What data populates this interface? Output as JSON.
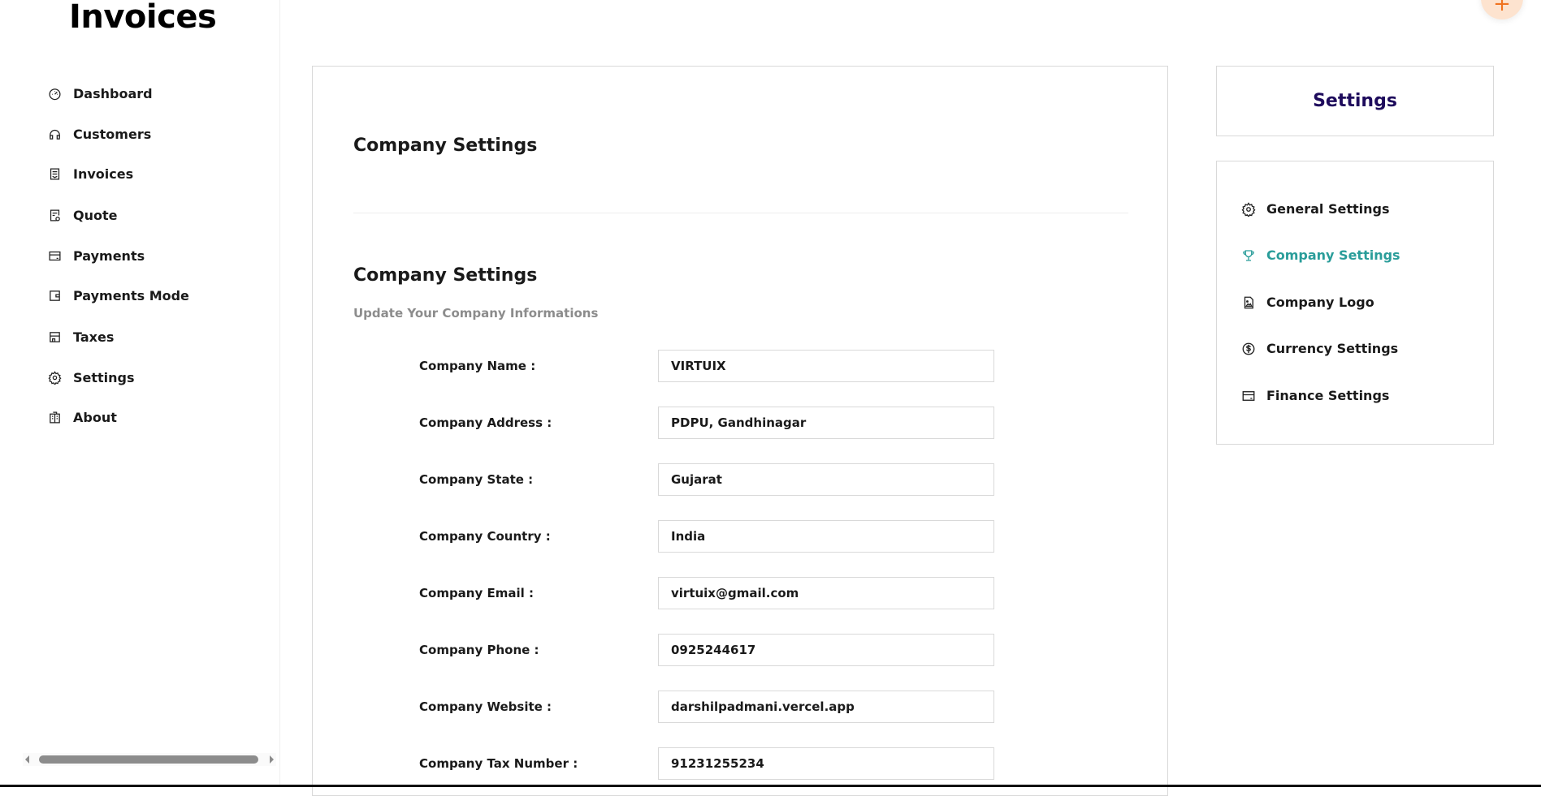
{
  "sidebar": {
    "brand": "Invoices",
    "items": [
      {
        "label": "Dashboard",
        "icon": "dashboard-icon"
      },
      {
        "label": "Customers",
        "icon": "headphones-icon"
      },
      {
        "label": "Invoices",
        "icon": "invoice-icon"
      },
      {
        "label": "Quote",
        "icon": "quote-icon"
      },
      {
        "label": "Payments",
        "icon": "credit-card-icon"
      },
      {
        "label": "Payments Mode",
        "icon": "wallet-icon"
      },
      {
        "label": "Taxes",
        "icon": "shop-icon"
      },
      {
        "label": "Settings",
        "icon": "gear-icon"
      },
      {
        "label": "About",
        "icon": "building-icon"
      }
    ]
  },
  "main": {
    "title": "Company Settings",
    "section_title": "Company Settings",
    "subtitle": "Update Your Company Informations",
    "fields": [
      {
        "label": "Company Name",
        "value": "VIRTUIX"
      },
      {
        "label": "Company Address",
        "value": "PDPU, Gandhinagar"
      },
      {
        "label": "Company State",
        "value": "Gujarat"
      },
      {
        "label": "Company Country",
        "value": "India"
      },
      {
        "label": "Company Email",
        "value": "virtuix@gmail.com"
      },
      {
        "label": "Company Phone",
        "value": "0925244617"
      },
      {
        "label": "Company Website",
        "value": "darshilpadmani.vercel.app"
      },
      {
        "label": "Company Tax Number",
        "value": "91231255234"
      }
    ]
  },
  "settings_panel": {
    "title": "Settings",
    "items": [
      {
        "label": "General Settings",
        "icon": "gear-icon"
      },
      {
        "label": "Company Settings",
        "icon": "trophy-icon",
        "active": true
      },
      {
        "label": "Company Logo",
        "icon": "file-image-icon"
      },
      {
        "label": "Currency Settings",
        "icon": "dollar-circle-icon"
      },
      {
        "label": "Finance Settings",
        "icon": "credit-card-icon"
      }
    ]
  },
  "fab": {
    "label": "+"
  },
  "colors": {
    "accent": "#2a9d9a",
    "settings_title": "#1e0b5c",
    "fab_bg": "#fde3cf",
    "fab_fg": "#f0731f"
  }
}
